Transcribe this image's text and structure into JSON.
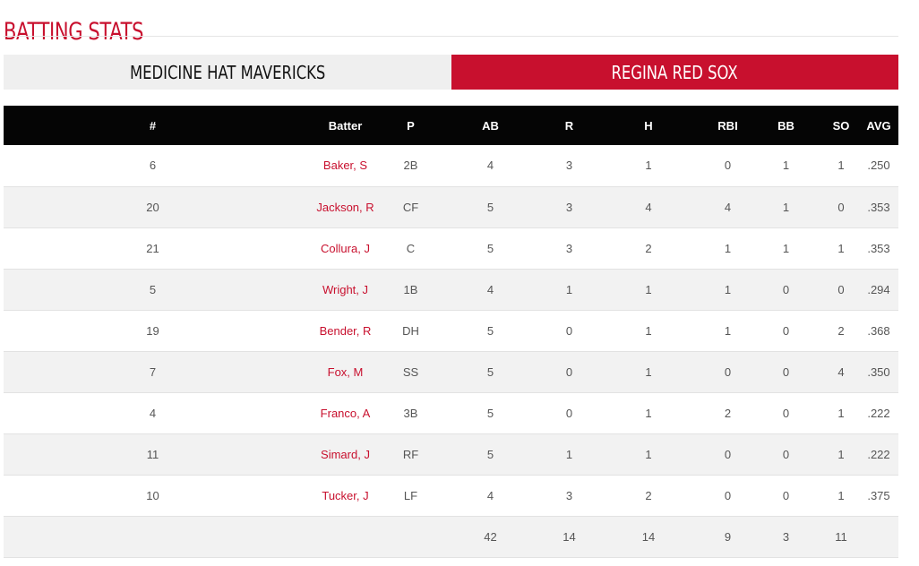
{
  "page": {
    "title": "BATTING STATS"
  },
  "colors": {
    "accent": "#c8102e",
    "header_bg": "#050505",
    "inactive_tab_bg": "#efefef",
    "stripe_bg": "#f2f2f2"
  },
  "teams": [
    {
      "name": "MEDICINE HAT MAVERICKS",
      "active": false
    },
    {
      "name": "REGINA RED SOX",
      "active": true
    }
  ],
  "table": {
    "columns": [
      "#",
      "Batter",
      "P",
      "AB",
      "R",
      "H",
      "RBI",
      "BB",
      "SO",
      "AVG"
    ],
    "rows": [
      {
        "num": "6",
        "batter": "Baker, S",
        "pos": "2B",
        "ab": "4",
        "r": "3",
        "h": "1",
        "rbi": "0",
        "bb": "1",
        "so": "1",
        "avg": ".250"
      },
      {
        "num": "20",
        "batter": "Jackson, R",
        "pos": "CF",
        "ab": "5",
        "r": "3",
        "h": "4",
        "rbi": "4",
        "bb": "1",
        "so": "0",
        "avg": ".353"
      },
      {
        "num": "21",
        "batter": "Collura, J",
        "pos": "C",
        "ab": "5",
        "r": "3",
        "h": "2",
        "rbi": "1",
        "bb": "1",
        "so": "1",
        "avg": ".353"
      },
      {
        "num": "5",
        "batter": "Wright, J",
        "pos": "1B",
        "ab": "4",
        "r": "1",
        "h": "1",
        "rbi": "1",
        "bb": "0",
        "so": "0",
        "avg": ".294"
      },
      {
        "num": "19",
        "batter": "Bender, R",
        "pos": "DH",
        "ab": "5",
        "r": "0",
        "h": "1",
        "rbi": "1",
        "bb": "0",
        "so": "2",
        "avg": ".368"
      },
      {
        "num": "7",
        "batter": "Fox, M",
        "pos": "SS",
        "ab": "5",
        "r": "0",
        "h": "1",
        "rbi": "0",
        "bb": "0",
        "so": "4",
        "avg": ".350"
      },
      {
        "num": "4",
        "batter": "Franco, A",
        "pos": "3B",
        "ab": "5",
        "r": "0",
        "h": "1",
        "rbi": "2",
        "bb": "0",
        "so": "1",
        "avg": ".222"
      },
      {
        "num": "11",
        "batter": "Simard, J",
        "pos": "RF",
        "ab": "5",
        "r": "1",
        "h": "1",
        "rbi": "0",
        "bb": "0",
        "so": "1",
        "avg": ".222"
      },
      {
        "num": "10",
        "batter": "Tucker, J",
        "pos": "LF",
        "ab": "4",
        "r": "3",
        "h": "2",
        "rbi": "0",
        "bb": "0",
        "so": "1",
        "avg": ".375"
      }
    ],
    "totals": {
      "num": "",
      "batter": "",
      "pos": "",
      "ab": "42",
      "r": "14",
      "h": "14",
      "rbi": "9",
      "bb": "3",
      "so": "11",
      "avg": ""
    }
  }
}
